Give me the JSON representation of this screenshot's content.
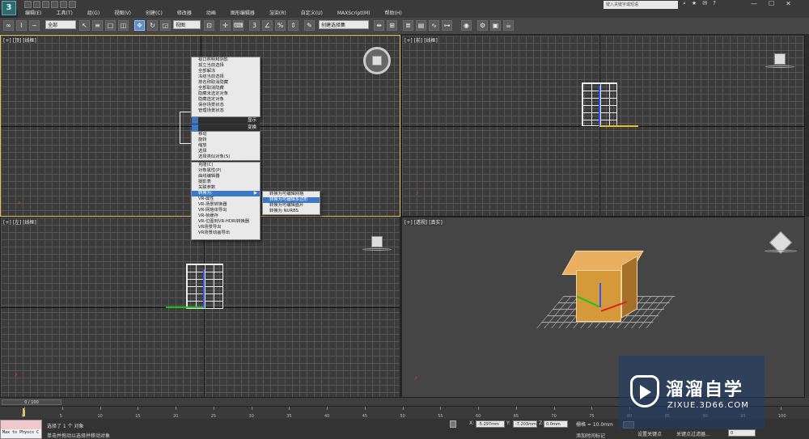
{
  "app": {
    "logo": "3"
  },
  "titlebar": {
    "search_placeholder": "键入关键字或短语",
    "window_controls": [
      "—",
      "☐",
      "✕"
    ]
  },
  "menubar": [
    "编辑(E)",
    "工具(T)",
    "组(G)",
    "视图(V)",
    "创建(C)",
    "修改器",
    "动画",
    "图形编辑器",
    "渲染(R)",
    "自定义(U)",
    "MAXScript(M)",
    "帮助(H)"
  ],
  "toolbar": {
    "selection_filter": "全部",
    "ref_coord": "视图",
    "named_selection": "创建选择集"
  },
  "viewports": {
    "top": "[+] [顶] [线框]",
    "front": "[+] [前] [线框]",
    "left": "[+] [左] [线框]",
    "persp": "[+] [透视] [真实]"
  },
  "quad_menu": {
    "items": [
      "视口照明和阴影",
      "孤立当前选择",
      "全部解冻",
      "冻结当前选择",
      "按名称取消隐藏",
      "全部取消隐藏",
      "隐藏未选定对象",
      "隐藏选定对象",
      "保存场景状态",
      "管理场景状态"
    ],
    "quad_labels": [
      "显示",
      "变换"
    ],
    "transform_items": [
      "移动",
      "旋转",
      "缩放",
      "选择",
      "选择类似对象(S)"
    ],
    "edit_items": [
      "克隆(C)",
      "对象属性(P)",
      "曲线编辑器",
      "摄影表",
      "关联参数",
      "转换为:",
      "VR-属性",
      "VR-场景转换器",
      "VR-网格体导出",
      "VR-帧缓存",
      "VR-位图到VR-HDRI转换器",
      "VR场景导出",
      "VR场景动画导出"
    ],
    "convert_item": "转换为:",
    "submenu": [
      "转换为可编辑网格",
      "转换为可编辑多边形",
      "转换为可编辑面片",
      "转换为 NURBS"
    ],
    "submenu_highlight_index": 1
  },
  "timeline": {
    "slider": "0 / 100",
    "ticks": [
      "0",
      "5",
      "10",
      "15",
      "20",
      "25",
      "30",
      "35",
      "40",
      "45",
      "50",
      "55",
      "60",
      "65",
      "70",
      "75",
      "80",
      "85",
      "90",
      "95",
      "100"
    ]
  },
  "status": {
    "maxscript_listener": "Max to Physcs C",
    "selected": "选择了 1 个 对象",
    "prompt": "单击并拖动以选择并移动对象",
    "x_label": "X:",
    "x_value": "-5.297mm",
    "y_label": "Y:",
    "y_value": "-7.203mm",
    "z_label": "Z:",
    "z_value": "0.0mm",
    "grid": "栅格 = 10.0mm",
    "add_time_tag": "添加时间标记",
    "set_key": "设置关键点",
    "key_filter": "关键点过滤器...",
    "frame": "0"
  },
  "watermark": {
    "name_cn": "溜溜自学",
    "url": "ZIXUE.3D66.COM"
  },
  "colors": {
    "accent": "#3c78c8",
    "active_viewport": "#e5c15a",
    "box": "#d49a3a"
  }
}
